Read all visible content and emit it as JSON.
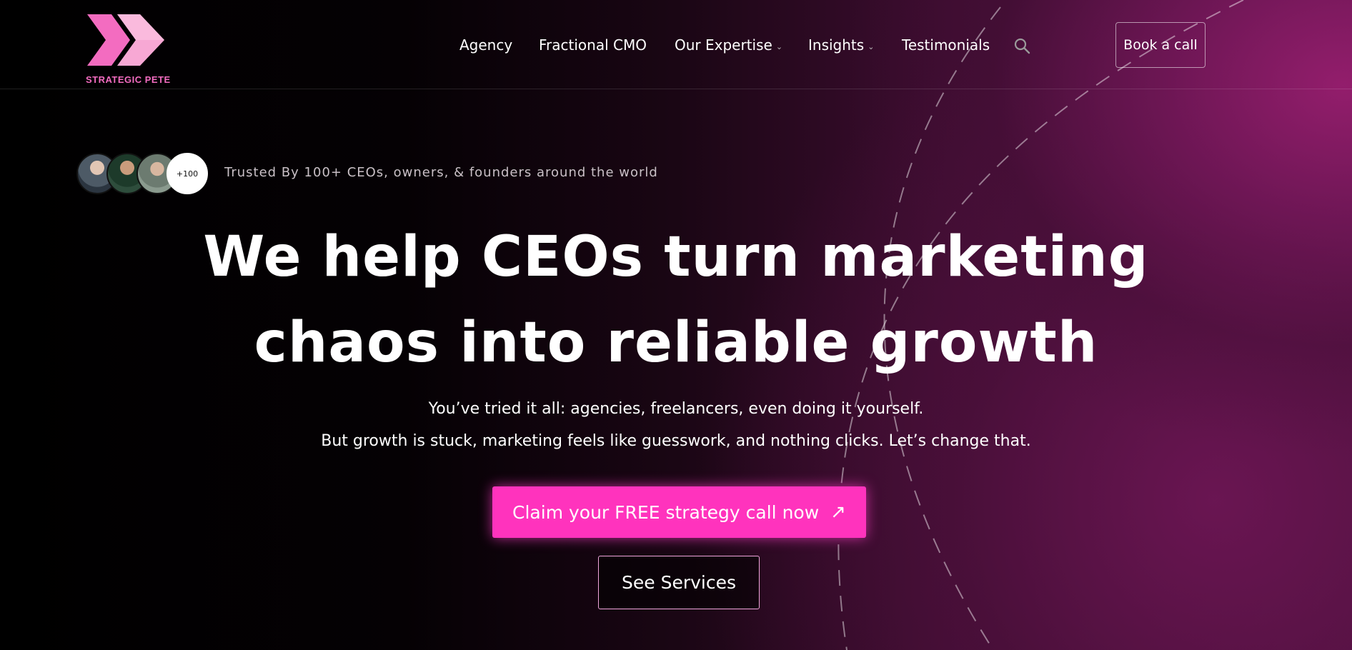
{
  "brand": {
    "name": "STRATEGIC PETE",
    "colors": {
      "accent": "#ff33bd",
      "logo_pink": "#f36cc0",
      "logo_light": "#f7a8d4"
    }
  },
  "nav": {
    "items": [
      {
        "label": "Agency",
        "has_dropdown": false
      },
      {
        "label": "Fractional CMO",
        "has_dropdown": false
      },
      {
        "label": "Our Expertise",
        "has_dropdown": true
      },
      {
        "label": "Insights",
        "has_dropdown": true
      },
      {
        "label": "Testimonials",
        "has_dropdown": false
      }
    ],
    "search_icon": "search-icon",
    "book_label": "Book a call"
  },
  "trust": {
    "count_badge": "+100",
    "text": "Trusted By 100+ CEOs, owners, & founders around the world"
  },
  "hero": {
    "title_line1": "We help CEOs turn marketing",
    "title_line2": "chaos into reliable growth",
    "sub_line1": "You’ve tried it all: agencies, freelancers, even doing it yourself.",
    "sub_line2": "But growth is stuck, marketing feels like guesswork, and nothing clicks. Let’s change that.",
    "cta_label": "Claim your FREE strategy call now",
    "cta_icon": "arrow-up-right-icon",
    "secondary_label": "See Services"
  }
}
